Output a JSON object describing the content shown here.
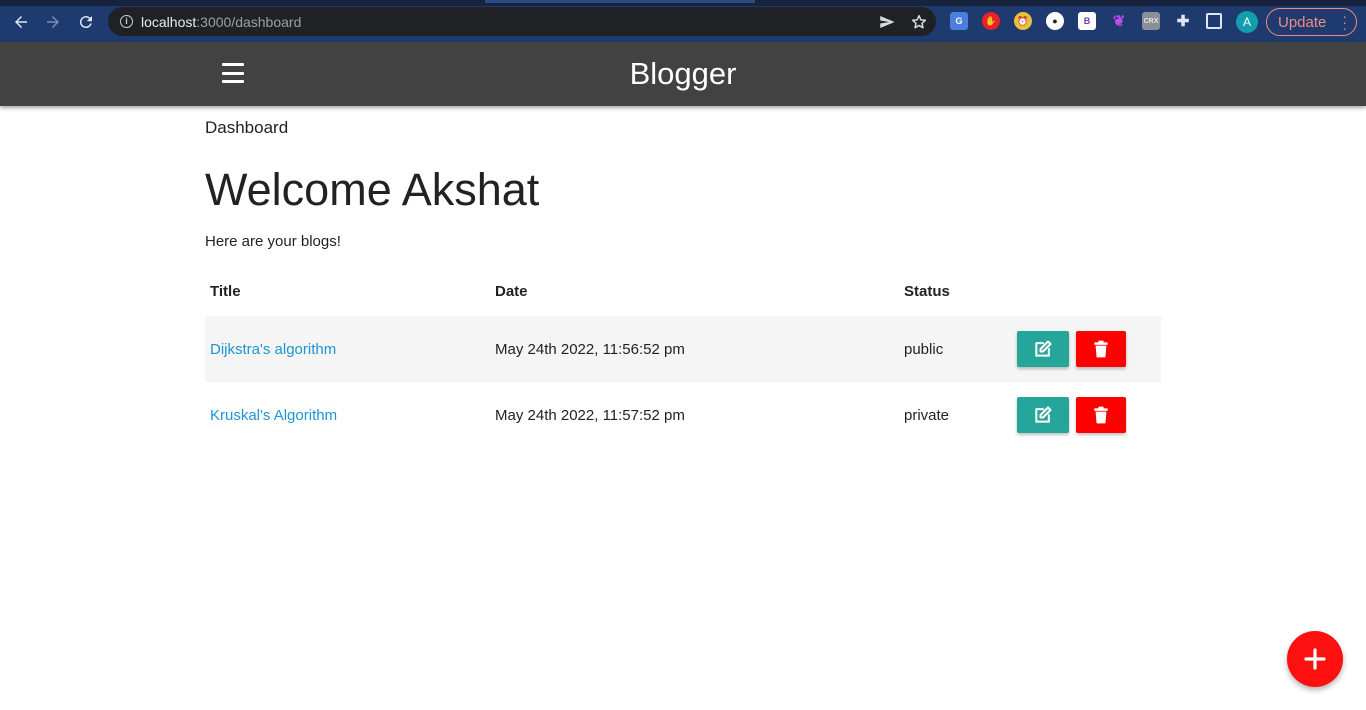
{
  "browser": {
    "url_host": "localhost",
    "url_path": ":3000/dashboard",
    "update_label": "Update",
    "profile_initial": "A",
    "extensions": [
      "google-translate-icon",
      "adblock-icon",
      "alarm-icon",
      "dev-extension-icon",
      "b-extension-icon",
      "feather-icon",
      "crx-extension-icon",
      "puzzle-icon",
      "side-panel-icon"
    ]
  },
  "appbar": {
    "brand": "Blogger"
  },
  "page": {
    "breadcrumb": "Dashboard",
    "heading": "Welcome Akshat",
    "subtitle": "Here are your blogs!"
  },
  "table": {
    "headers": {
      "title": "Title",
      "date": "Date",
      "status": "Status"
    },
    "rows": [
      {
        "title": "Dijkstra's algorithm",
        "date": "May 24th 2022, 11:56:52 pm",
        "status": "public"
      },
      {
        "title": "Kruskal's Algorithm",
        "date": "May 24th 2022, 11:57:52 pm",
        "status": "private"
      }
    ]
  },
  "colors": {
    "appbar": "#424242",
    "edit_button": "#26a69a",
    "delete_button": "#ff0000",
    "fab": "#ff1010",
    "link": "#1e95d4"
  }
}
